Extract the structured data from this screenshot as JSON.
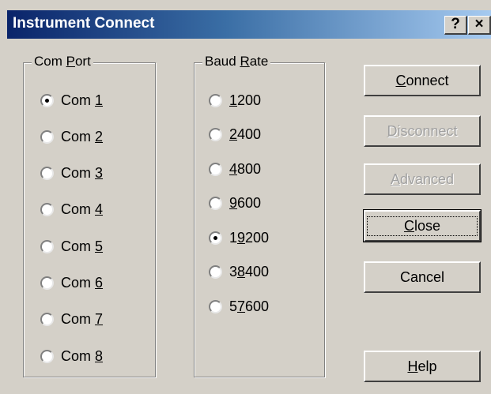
{
  "window": {
    "title": "Instrument Connect",
    "help_glyph": "?",
    "close_glyph": "×"
  },
  "com_port": {
    "legend": "Com Port",
    "selected": "Com 1",
    "options": [
      "Com 1",
      "Com 2",
      "Com 3",
      "Com 4",
      "Com 5",
      "Com 6",
      "Com 7",
      "Com 8"
    ]
  },
  "baud_rate": {
    "legend": "Baud Rate",
    "selected": "19200",
    "options": [
      "1200",
      "2400",
      "4800",
      "9600",
      "19200",
      "38400",
      "57600"
    ]
  },
  "buttons": {
    "connect": "Connect",
    "disconnect": "Disconnect",
    "advanced": "Advanced",
    "close": "Close",
    "cancel": "Cancel",
    "help": "Help"
  },
  "colors": {
    "titlebar_start": "#0a246a",
    "titlebar_end": "#a6caf0",
    "face": "#d4d0c8"
  }
}
